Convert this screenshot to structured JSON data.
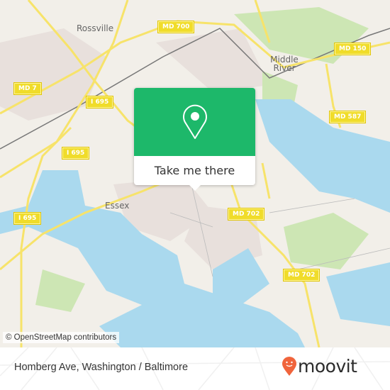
{
  "map": {
    "places": [
      {
        "id": "rossville",
        "label": "Rossville"
      },
      {
        "id": "middle-river",
        "label": "Middle River"
      },
      {
        "id": "essex",
        "label": "Essex"
      }
    ],
    "shields": [
      {
        "id": "md700",
        "label": "MD 700"
      },
      {
        "id": "md150",
        "label": "MD 150"
      },
      {
        "id": "md7",
        "label": "MD 7"
      },
      {
        "id": "i695-a",
        "label": "I 695"
      },
      {
        "id": "i695-b",
        "label": "I 695"
      },
      {
        "id": "i695-c",
        "label": "I 695"
      },
      {
        "id": "md587",
        "label": "MD 587"
      },
      {
        "id": "md702-a",
        "label": "MD 702"
      },
      {
        "id": "md702-b",
        "label": "MD 702"
      }
    ],
    "attribution": "© OpenStreetMap contributors",
    "colors": {
      "land": "#f2efe9",
      "water": "#aad9ee",
      "park": "#cde6b4",
      "road": "#f7e36a",
      "urban": "#e8e0dc"
    }
  },
  "popup": {
    "button_label": "Take me there",
    "icon": "map-pin-icon",
    "color": "#1db86a"
  },
  "footer": {
    "location_title": "Homberg Ave, Washington / Baltimore",
    "brand": "moovit",
    "brand_color": "#f0643c"
  }
}
